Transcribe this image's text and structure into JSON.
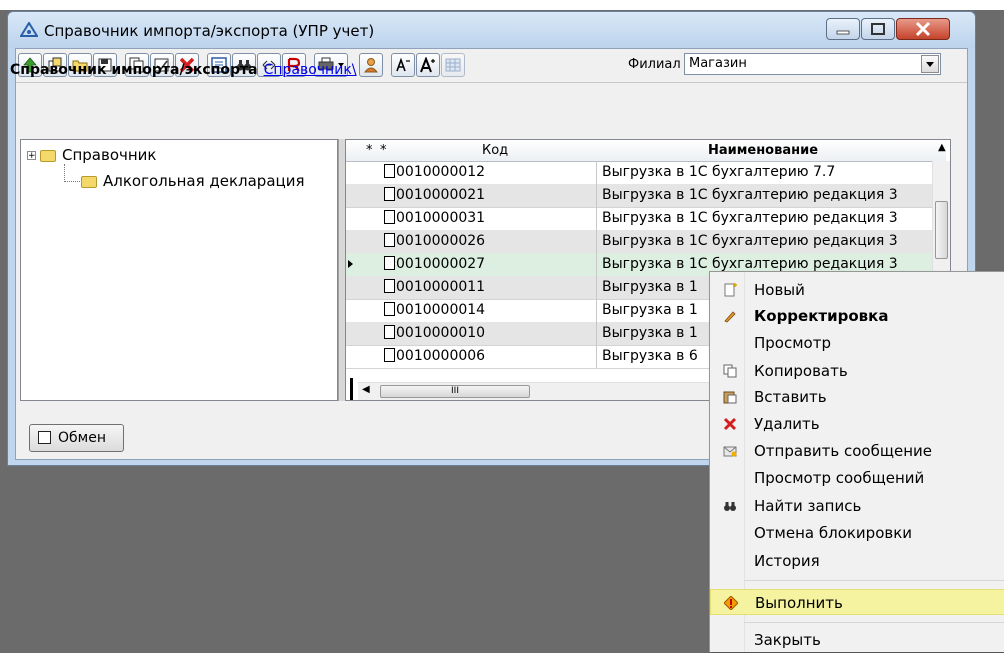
{
  "window": {
    "title": "Справочник импорта/экспорта (УПР учет)"
  },
  "toolbar": {
    "buttons": [
      "up-arrow-icon",
      "new-folder-icon",
      "folder-icon",
      "save-icon",
      "copy-icon",
      "paste-icon",
      "delete-icon",
      "list-icon",
      "binoculars-icon",
      "filter-icon",
      "report-icon",
      "print-icon",
      "user-icon",
      "font-decrease-icon",
      "font-increase-icon",
      "grid-icon"
    ],
    "filial_label": "Филиал",
    "filial_value": "Магазин"
  },
  "breadcrumb": {
    "title": "Справочник импорта/экспорта",
    "link": "Справочник\\"
  },
  "tree": {
    "root": "Справочник",
    "child": "Алкогольная декларация"
  },
  "grid": {
    "columns": [
      "*",
      "*",
      "Код",
      "Наименование"
    ],
    "rows": [
      {
        "code": "0010000012",
        "name": "Выгрузка  в 1С бухгалтерию 7.7"
      },
      {
        "code": "0010000021",
        "name": "Выгрузка  в 1С бухгалтерию редакция 3"
      },
      {
        "code": "0010000031",
        "name": "Выгрузка  в 1С бухгалтерию редакция 3"
      },
      {
        "code": "0010000026",
        "name": "Выгрузка  в 1С бухгалтерию редакция 3"
      },
      {
        "code": "0010000027",
        "name": "Выгрузка  в 1С бухгалтерию редакция 3"
      },
      {
        "code": "0010000011",
        "name": "Выгрузка  в 1"
      },
      {
        "code": "0010000014",
        "name": "Выгрузка  в 1"
      },
      {
        "code": "0010000010",
        "name": "Выгрузка  в 1"
      },
      {
        "code": "0010000006",
        "name": "Выгрузка  в 6"
      }
    ],
    "selected_index": 4,
    "hscroll_grip": "III"
  },
  "footer": {
    "exchange_label": "Обмен"
  },
  "context_menu": {
    "items": [
      {
        "label": "Новый",
        "icon": "new-icon"
      },
      {
        "label": "Корректировка",
        "icon": "pencil-icon",
        "bold": true
      },
      {
        "label": "Просмотр",
        "icon": ""
      },
      {
        "label": "Копировать",
        "icon": "copy-icon"
      },
      {
        "label": "Вставить",
        "icon": "paste-icon"
      },
      {
        "label": "Удалить",
        "icon": "delete-icon"
      },
      {
        "label": "Отправить сообщение",
        "icon": "envelope-icon"
      },
      {
        "label": "Просмотр сообщений",
        "icon": ""
      },
      {
        "label": "Найти запись",
        "icon": "binoculars-icon"
      },
      {
        "label": "Отмена блокировки",
        "icon": ""
      },
      {
        "label": "История",
        "icon": ""
      },
      {
        "label": "Выполнить",
        "icon": "execute-icon",
        "highlight": true
      },
      {
        "label": "Закрыть",
        "icon": ""
      }
    ]
  },
  "colors": {
    "selected_row": "#dcefe0",
    "menu_highlight": "#f5f3a0",
    "link": "#0000ee"
  }
}
